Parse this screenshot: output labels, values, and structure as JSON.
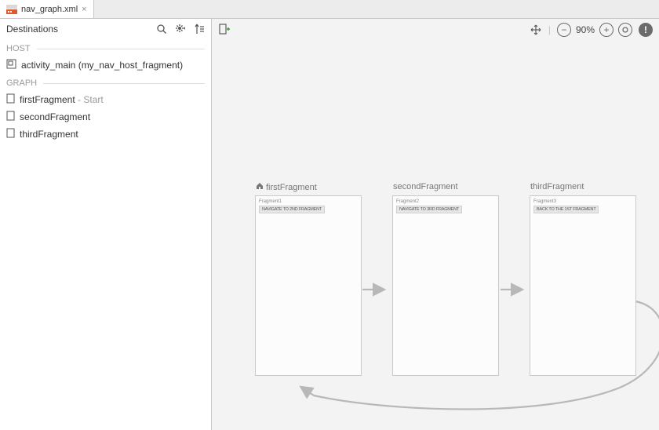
{
  "tab": {
    "filename": "nav_graph.xml"
  },
  "sidebar": {
    "title": "Destinations",
    "sections": {
      "host": {
        "label": "HOST",
        "item": "activity_main (my_nav_host_fragment)"
      },
      "graph": {
        "label": "GRAPH",
        "items": [
          {
            "name": "firstFragment",
            "suffix": " - Start"
          },
          {
            "name": "secondFragment",
            "suffix": ""
          },
          {
            "name": "thirdFragment",
            "suffix": ""
          }
        ]
      }
    }
  },
  "canvas": {
    "zoom_label": "90%",
    "fragments": [
      {
        "title": "firstFragment",
        "is_home": true,
        "body_label": "Fragment1",
        "button_text": "NAVIGATE TO 2ND FRAGMENT"
      },
      {
        "title": "secondFragment",
        "is_home": false,
        "body_label": "Fragment2",
        "button_text": "NAVIGATE TO 3RD FRAGMENT"
      },
      {
        "title": "thirdFragment",
        "is_home": false,
        "body_label": "Fragment3",
        "button_text": "BACK TO THE 1ST FRAGMENT"
      }
    ]
  }
}
